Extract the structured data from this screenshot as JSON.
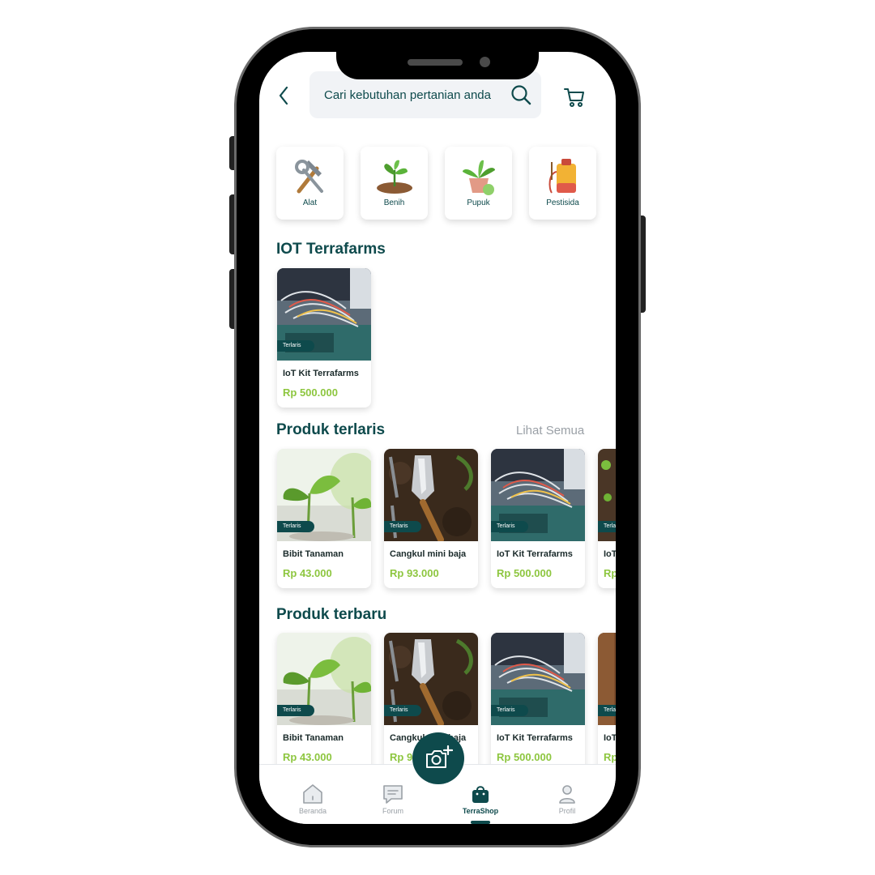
{
  "search": {
    "placeholder": "Cari kebutuhan pertanian anda"
  },
  "categories": [
    {
      "label": "Alat",
      "icon": "tools-icon"
    },
    {
      "label": "Benih",
      "icon": "seedling-icon"
    },
    {
      "label": "Pupuk",
      "icon": "potted-plant-icon"
    },
    {
      "label": "Pestisida",
      "icon": "sprayer-icon"
    }
  ],
  "iot_section": {
    "title": "IOT Terrafarms",
    "products": [
      {
        "name": "IoT Kit Terrafarms",
        "price": "Rp 500.000",
        "badge": "Terlaris",
        "image": "electronics"
      }
    ]
  },
  "bestseller_section": {
    "title": "Produk terlaris",
    "see_all": "Lihat Semua",
    "products": [
      {
        "name": "Bibit Tanaman",
        "price": "Rp 43.000",
        "badge": "Terlaris",
        "image": "seedling"
      },
      {
        "name": "Cangkul mini baja",
        "price": "Rp 93.000",
        "badge": "Terlaris",
        "image": "trowel"
      },
      {
        "name": "IoT Kit Terrafarms",
        "price": "Rp 500.000",
        "badge": "Terlaris",
        "image": "electronics"
      },
      {
        "name": "IoT",
        "price": "Rp",
        "badge": "Terlaris",
        "image": "soil"
      }
    ]
  },
  "newest_section": {
    "title": "Produk terbaru",
    "products": [
      {
        "name": "Bibit Tanaman",
        "price": "Rp 43.000",
        "badge": "Terlaris",
        "image": "seedling"
      },
      {
        "name": "Cangkul mini baja",
        "price": "Rp 93.000",
        "badge": "Terlaris",
        "image": "trowel"
      },
      {
        "name": "IoT Kit Terrafarms",
        "price": "Rp 500.000",
        "badge": "Terlaris",
        "image": "electronics"
      },
      {
        "name": "IoT",
        "price": "Rp",
        "badge": "Terlaris",
        "image": "wood"
      }
    ]
  },
  "bottom_nav": {
    "items": [
      {
        "label": "Beranda",
        "icon": "home-icon"
      },
      {
        "label": "Forum",
        "icon": "chat-icon"
      },
      {
        "label": "TerraShop",
        "icon": "shopping-bag-icon",
        "active": true
      },
      {
        "label": "Profil",
        "icon": "user-icon"
      }
    ]
  },
  "colors": {
    "primary": "#0e4a4c",
    "price": "#8dc63f",
    "muted": "#9aa0a6"
  }
}
